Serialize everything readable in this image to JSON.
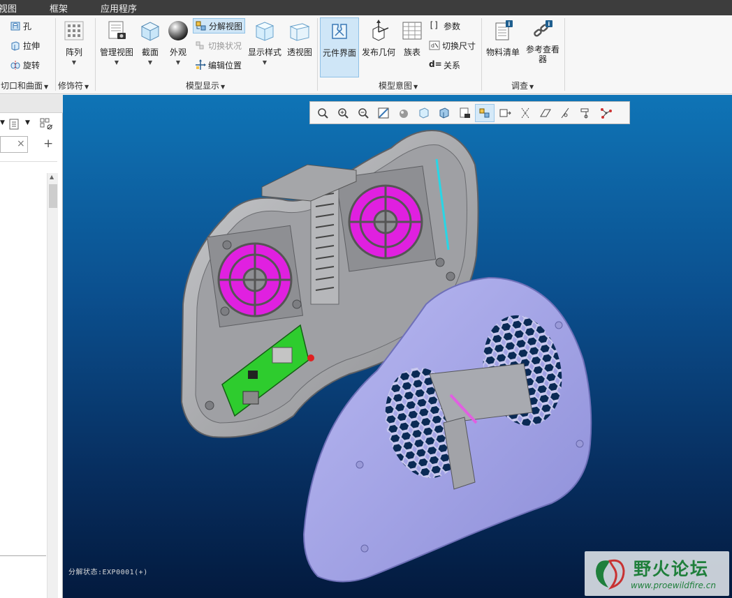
{
  "menu": {
    "items": [
      "视图",
      "框架",
      "应用程序"
    ]
  },
  "ribbon": {
    "cut_group": {
      "hole": "孔",
      "extrude": "拉伸",
      "revolve": "旋转",
      "label": "切口和曲面"
    },
    "modifier_group": {
      "pattern": "阵列",
      "label": "修饰符"
    },
    "model_display_group": {
      "manage_views": "管理视图",
      "section": "截面",
      "appearance": "外观",
      "explode_view": "分解视图",
      "toggle_state": "切换状况",
      "edit_position": "编辑位置",
      "display_style": "显示样式",
      "perspective": "透视图",
      "label": "模型显示"
    },
    "model_intent_group": {
      "component_interface": "元件界面",
      "publish_geometry": "发布几何",
      "family_table": "族表",
      "parameters": "参数",
      "switch_dimensions": "切换尺寸",
      "relations": "关系",
      "label": "模型意图"
    },
    "investigate_group": {
      "bom": "物料清单",
      "reference_viewer": "参考查看器",
      "label": "调查"
    }
  },
  "left_panel": {
    "search_clear": "×",
    "add": "+"
  },
  "viewport": {
    "status": "分解状态:EXP0001(+)"
  },
  "watermark": {
    "title": "野火论坛",
    "url": "www.proewildfire.cn"
  },
  "colors": {
    "menubar": "#3d3d3d",
    "viewport_top": "#0f74b6",
    "viewport_bottom": "#031a3e",
    "fan_magenta": "#e020e0",
    "pcb_green": "#2ecc2e",
    "shell_gray": "#a9aaad",
    "cover_lavender": "#a9a9e8",
    "watermark_green": "#1f7f3b"
  }
}
